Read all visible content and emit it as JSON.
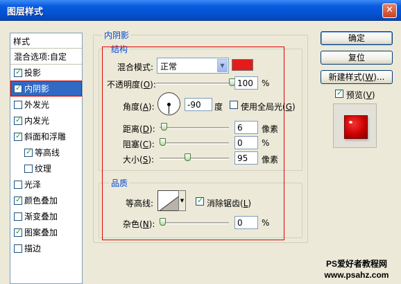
{
  "window": {
    "title": "图层样式",
    "close_glyph": "✕"
  },
  "styles_panel": {
    "header": "样式",
    "items": [
      {
        "label": "混合选项:自定",
        "checkbox": false,
        "checked": false,
        "indent": false,
        "selected": false
      },
      {
        "label": "投影",
        "checkbox": true,
        "checked": true,
        "indent": false,
        "selected": false
      },
      {
        "label": "内阴影",
        "checkbox": true,
        "checked": true,
        "indent": false,
        "selected": true
      },
      {
        "label": "外发光",
        "checkbox": true,
        "checked": false,
        "indent": false,
        "selected": false
      },
      {
        "label": "内发光",
        "checkbox": true,
        "checked": true,
        "indent": false,
        "selected": false
      },
      {
        "label": "斜面和浮雕",
        "checkbox": true,
        "checked": true,
        "indent": false,
        "selected": false
      },
      {
        "label": "等高线",
        "checkbox": true,
        "checked": true,
        "indent": true,
        "selected": false
      },
      {
        "label": "纹理",
        "checkbox": true,
        "checked": false,
        "indent": true,
        "selected": false
      },
      {
        "label": "光泽",
        "checkbox": true,
        "checked": false,
        "indent": false,
        "selected": false
      },
      {
        "label": "颜色叠加",
        "checkbox": true,
        "checked": true,
        "indent": false,
        "selected": false
      },
      {
        "label": "渐变叠加",
        "checkbox": true,
        "checked": false,
        "indent": false,
        "selected": false
      },
      {
        "label": "图案叠加",
        "checkbox": true,
        "checked": true,
        "indent": false,
        "selected": false
      },
      {
        "label": "描边",
        "checkbox": true,
        "checked": false,
        "indent": false,
        "selected": false
      }
    ]
  },
  "inner_shadow": {
    "group_title": "内阴影",
    "structure": {
      "title": "结构",
      "blend_mode_label": "混合模式:",
      "blend_mode_value": "正常",
      "shadow_color": "#e41b1b",
      "opacity_label_pre": "不透明度(",
      "opacity_key": "O",
      "opacity_label_post": "):",
      "opacity_value": "100",
      "opacity_unit": "%",
      "opacity_fraction": 1.0,
      "angle_label_pre": "角度(",
      "angle_key": "A",
      "angle_label_post": "):",
      "angle_value": "-90",
      "angle_unit": "度",
      "global_light_label_pre": "使用全局光(",
      "global_light_key": "G",
      "global_light_label_post": ")",
      "global_light_checked": false,
      "distance_label_pre": "距离(",
      "distance_key": "D",
      "distance_label_post": "):",
      "distance_value": "6",
      "distance_unit": "像素",
      "distance_fraction": 0.02,
      "choke_label_pre": "阻塞(",
      "choke_key": "C",
      "choke_label_post": "):",
      "choke_value": "0",
      "choke_unit": "%",
      "choke_fraction": 0.0,
      "size_label_pre": "大小(",
      "size_key": "S",
      "size_label_post": "):",
      "size_value": "95",
      "size_unit": "像素",
      "size_fraction": 0.38
    },
    "quality": {
      "title": "品质",
      "contour_label": "等高线:",
      "anti_alias_label_pre": "消除锯齿(",
      "anti_alias_key": "L",
      "anti_alias_label_post": ")",
      "anti_alias_checked": true,
      "noise_label_pre": "杂色(",
      "noise_key": "N",
      "noise_label_post": "):",
      "noise_value": "0",
      "noise_unit": "%",
      "noise_fraction": 0.0
    }
  },
  "buttons": {
    "ok": "确定",
    "reset": "复位",
    "new_style_pre": "新建样式(",
    "new_style_key": "W",
    "new_style_post": ")...",
    "preview_pre": "预览(",
    "preview_key": "V",
    "preview_post": ")",
    "preview_checked": true
  },
  "watermark": {
    "line1": "PS爱好者教程网",
    "line2": "www.psahz.com"
  }
}
